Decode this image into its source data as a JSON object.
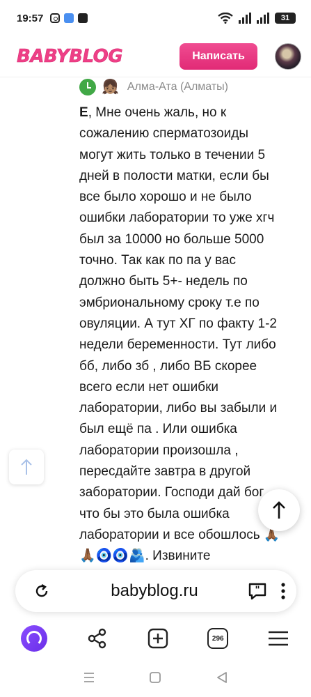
{
  "status_bar": {
    "time": "19:57",
    "battery": "31",
    "icons": [
      "instagram-icon",
      "cloud-app-icon",
      "message-app-icon",
      "wifi-icon",
      "signal-icon",
      "signal-icon",
      "battery-icon"
    ]
  },
  "header": {
    "logo": "BABYBLOG",
    "write_button": "Написать"
  },
  "post": {
    "location": "Алма-Ата (Алматы)",
    "addressee": "Е",
    "lines": [
      ", Мне очень жаль, но к",
      "сожалению сперматозоиды",
      "могут жить только в течении 5",
      "дней в полости матки, если бы",
      "все было хорошо и не было",
      "ошибки лаборатории то уже хгч",
      "был за 10000 но больше 5000",
      "точно. Так как по па у вас",
      "должно быть 5+- недель по",
      "эмбриональному сроку т.е по",
      "овуляции. А тут ХГ по факту 1-2",
      "недели беременности. Тут либо",
      "бб, либо зб , либо ВБ скорее",
      "всего если нет ошибки",
      "лаборатории, либо вы забыли и",
      "был ещё па . Или ошибка",
      "лаборатории произошла ,",
      "пересдайте завтра в другой",
      "заборатории. Господи дай бог",
      "что бы это была ошибка",
      "лаборатории и все обошлось 🙏🏾",
      "🙏🏾🧿🧿🫂. Извините"
    ]
  },
  "browser": {
    "url": "babyblog.ru",
    "tabs_count": "296"
  },
  "colors": {
    "brand_pink": "#ee3f86",
    "button_pink": "#e12a76",
    "alice_purple": "#7a3ef5"
  }
}
